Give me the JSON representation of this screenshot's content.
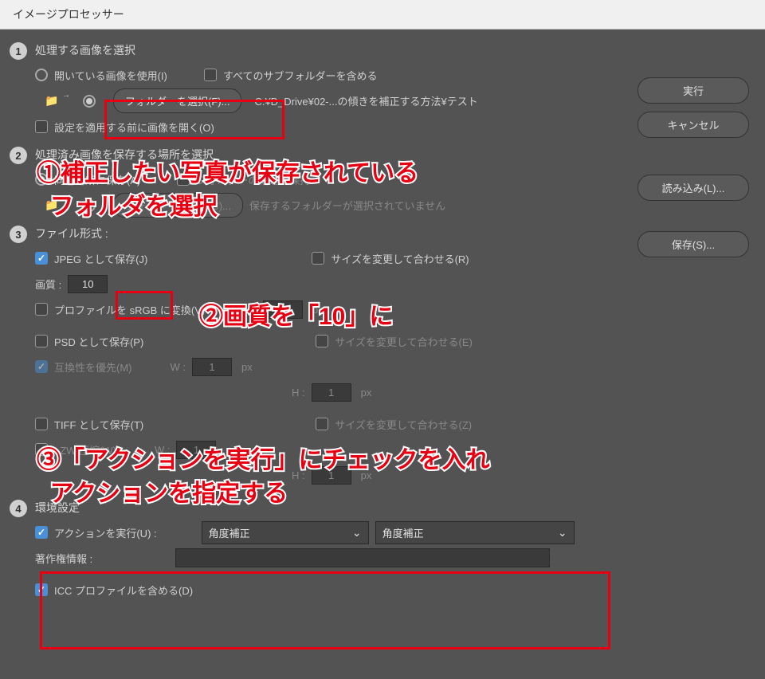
{
  "title": "イメージプロセッサー",
  "buttons": {
    "run": "実行",
    "cancel": "キャンセル",
    "load": "読み込み(L)...",
    "save": "保存(S)...",
    "select_folder": "フォルダーを選択(F)..."
  },
  "section1": {
    "title": "処理する画像を選択",
    "use_open": "開いている画像を使用(I)",
    "include_sub": "すべてのサブフォルダーを含める",
    "path": "C:¥D_Drive¥02-...の傾きを補正する方法¥テスト",
    "open_first": "設定を適用する前に画像を開く(O)"
  },
  "section2": {
    "title": "処理済み画像を保存する場所を選択",
    "same_loc": "同じ場所に保存(A)",
    "keep_struct": "フォルダーの構造を保持",
    "select_folder2": "フォルダーを選択(C)...",
    "not_selected": "保存するフォルダーが選択されていません"
  },
  "section3": {
    "title": "ファイル形式 :",
    "save_jpeg": "JPEG として保存(J)",
    "resize_r": "サイズを変更して合わせる(R)",
    "quality_label": "画質 :",
    "quality_value": "10",
    "srgb": "プロファイルを sRGB に変換(V)",
    "w": "W :",
    "h": "H :",
    "px": "px",
    "dim_val": "1",
    "save_psd": "PSD として保存(P)",
    "resize_e": "サイズを変更して合わせる(E)",
    "compat": "互換性を優先(M)",
    "save_tiff": "TIFF として保存(T)",
    "resize_z": "サイズを変更して合わせる(Z)",
    "lzw": "LZW 圧縮(W)"
  },
  "section4": {
    "title": "環境設定",
    "run_action": "アクションを実行(U) :",
    "action_set": "角度補正",
    "action_name": "角度補正",
    "copyright_label": "著作権情報 :",
    "include_icc": "ICC プロファイルを含める(D)"
  },
  "annotations": {
    "a1": "①補正したい写真が保存されている\nフォルダを選択",
    "a2": "②画質を「10」に",
    "a3": "③「アクションを実行」にチェックを入れ\nアクションを指定する"
  }
}
